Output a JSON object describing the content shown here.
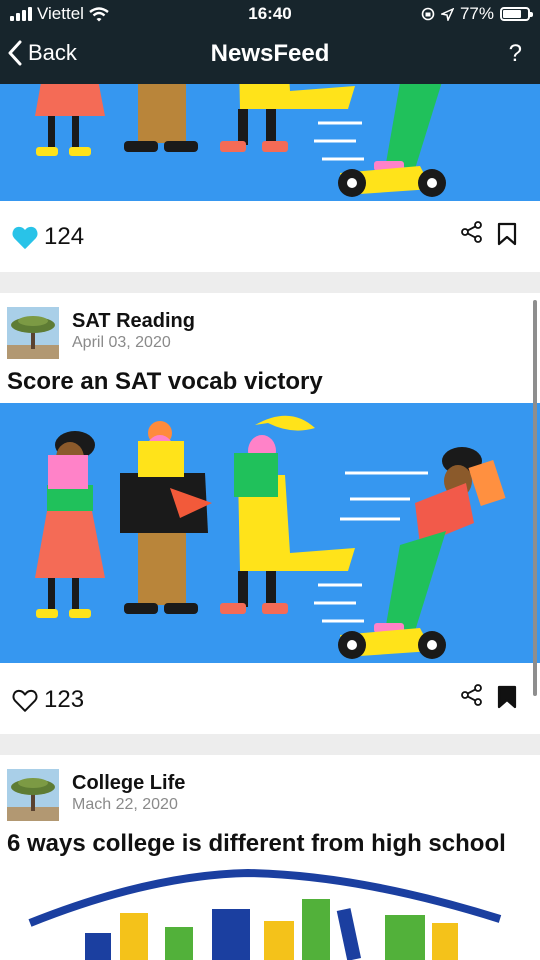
{
  "status": {
    "carrier": "Viettel",
    "time": "16:40",
    "battery": "77%",
    "battery_level": 0.77
  },
  "nav": {
    "back_label": "Back",
    "title": "NewsFeed",
    "help_label": "?"
  },
  "posts": [
    {
      "likes": "124",
      "liked": true,
      "bookmarked": false
    },
    {
      "source": "SAT Reading",
      "date": "April 03, 2020",
      "title": "Score an SAT vocab victory",
      "likes": "123",
      "liked": false,
      "bookmarked": true
    },
    {
      "source": "College Life",
      "date": "Mach 22, 2020",
      "title": "6 ways college is different from high school"
    }
  ],
  "colors": {
    "bar": "#17252c",
    "like_active": "#29c3e8",
    "illustration_bg": "#3697f0"
  }
}
